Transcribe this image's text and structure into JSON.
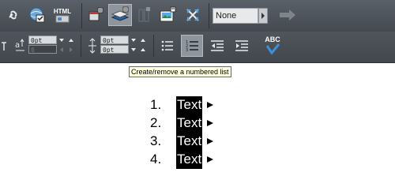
{
  "toolbar": {
    "row1": {
      "html_label": "HTML",
      "style_dropdown": {
        "value": "None"
      }
    },
    "row2": {
      "baseline_field": {
        "value": "0pt",
        "placeholder": "0"
      },
      "spacing_field_top": {
        "value": "0pt"
      },
      "spacing_field_bottom": {
        "value": "0pt"
      },
      "spellcheck_label": "ABC"
    }
  },
  "tooltip": "Create/remove a numbered list",
  "list": {
    "items": [
      {
        "number": "1.",
        "text": "Text"
      },
      {
        "number": "2.",
        "text": "Text"
      },
      {
        "number": "3.",
        "text": "Text"
      },
      {
        "number": "4.",
        "text": "Text"
      }
    ]
  },
  "colors": {
    "toolbar_bg": "#4b5159",
    "tooltip_bg": "#ffffe1",
    "selection_bg": "#000000"
  },
  "icons": [
    "link-icon",
    "web-properties-icon",
    "html-icon",
    "layers-icon",
    "text-frame-icon",
    "columns-icon",
    "image-icon",
    "transform-icon",
    "forward-arrow-icon",
    "align-top-icon",
    "baseline-shift-icon",
    "line-spacing-icon",
    "bullet-list-icon",
    "numbered-list-icon",
    "decrease-indent-icon",
    "increase-indent-icon",
    "spellcheck-icon"
  ]
}
